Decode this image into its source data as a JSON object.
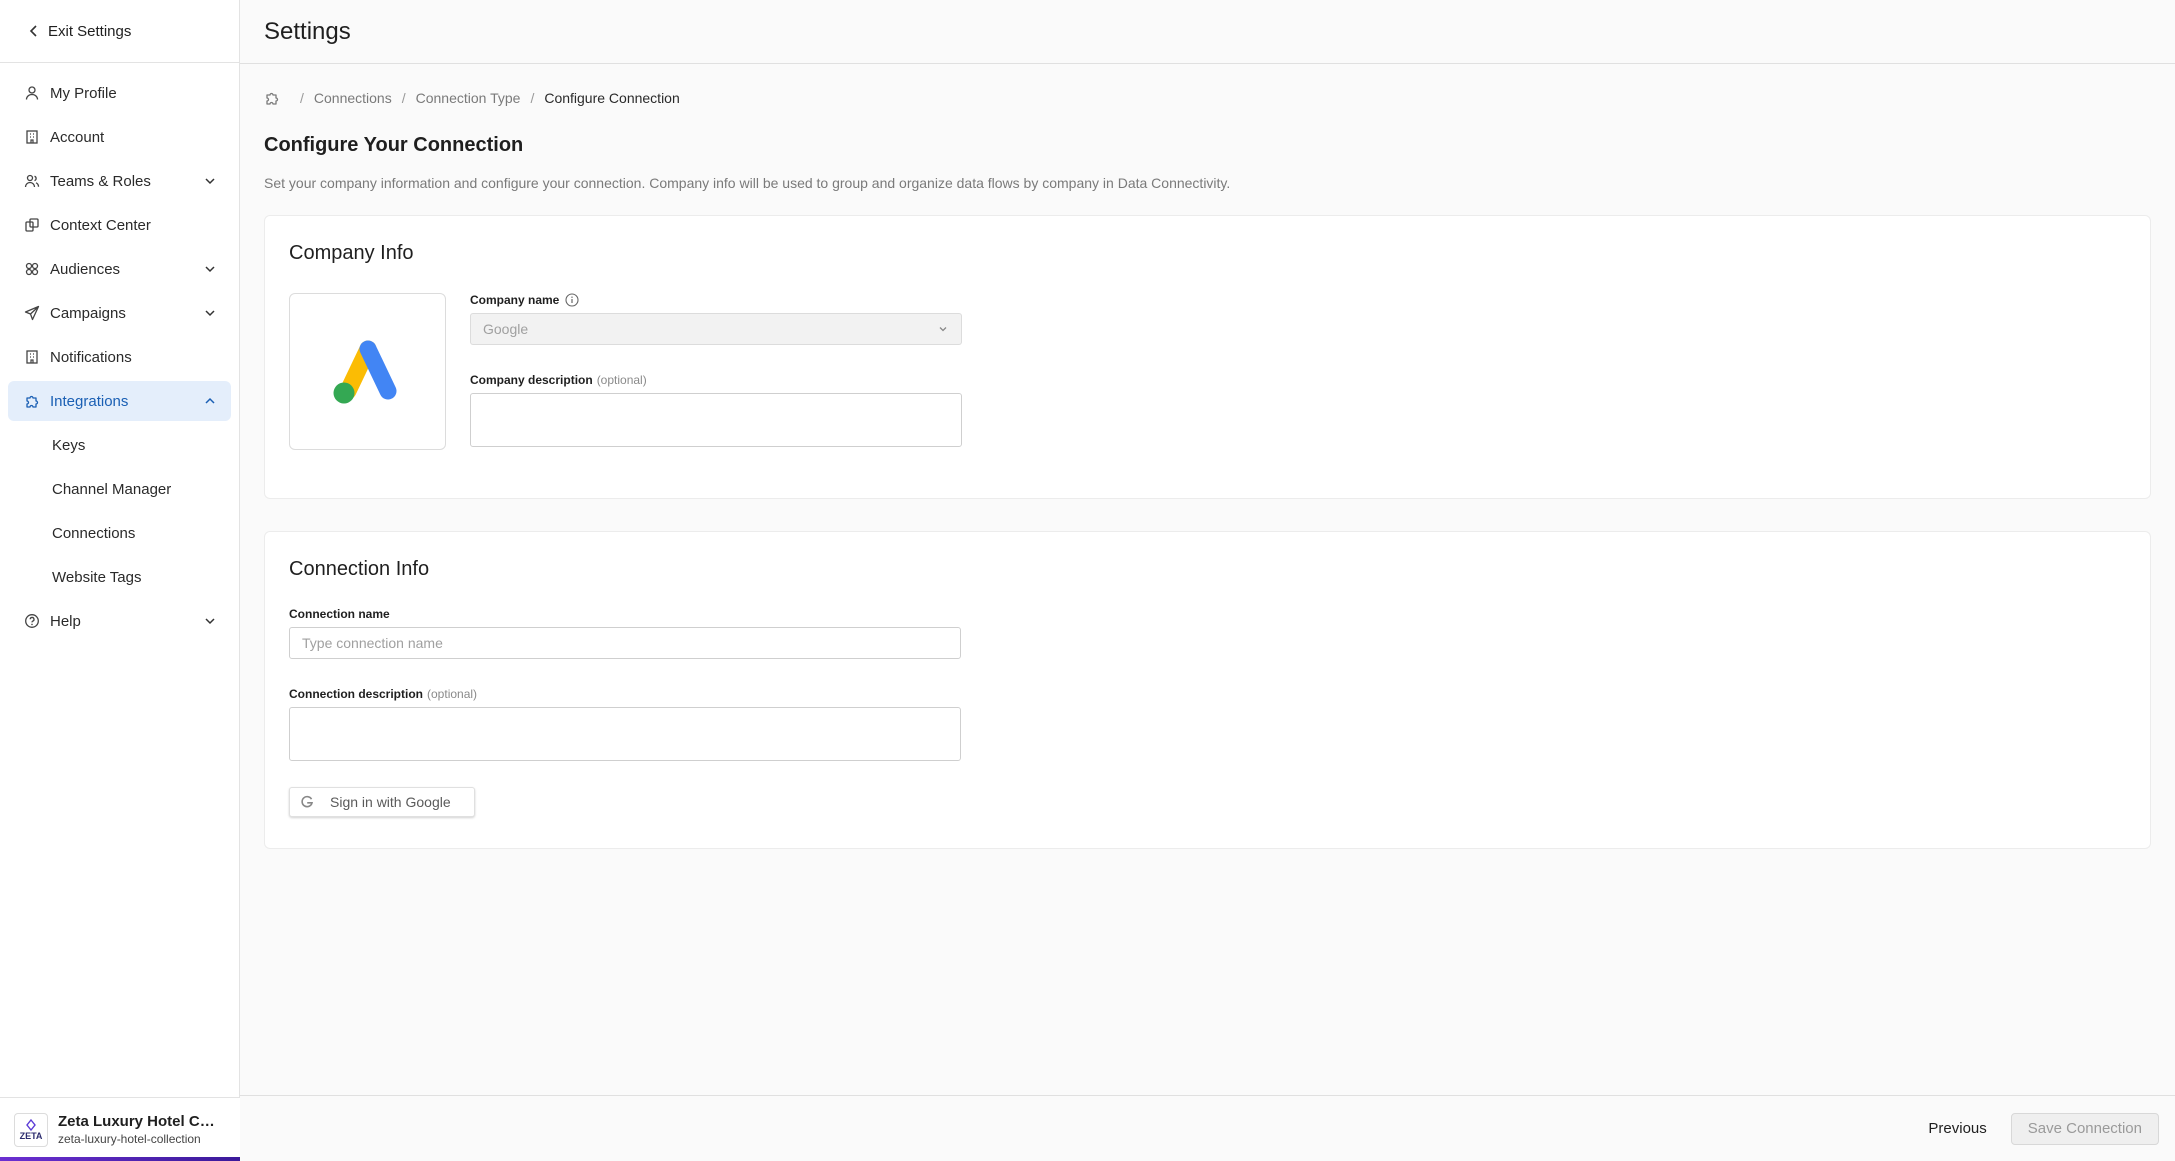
{
  "sidebar": {
    "exit_label": "Exit Settings",
    "items": [
      {
        "label": "My Profile"
      },
      {
        "label": "Account"
      },
      {
        "label": "Teams & Roles"
      },
      {
        "label": "Context Center"
      },
      {
        "label": "Audiences"
      },
      {
        "label": "Campaigns"
      },
      {
        "label": "Notifications"
      },
      {
        "label": "Integrations"
      },
      {
        "label": "Help"
      }
    ],
    "integrations_sub": [
      {
        "label": "Keys"
      },
      {
        "label": "Channel Manager"
      },
      {
        "label": "Connections"
      },
      {
        "label": "Website Tags"
      }
    ],
    "org": {
      "name": "Zeta Luxury Hotel Colle...",
      "slug": "zeta-luxury-hotel-collection",
      "logo_text": "ZETA"
    }
  },
  "header": {
    "title": "Settings"
  },
  "breadcrumb": {
    "items": [
      "Connections",
      "Connection Type"
    ],
    "current": "Configure Connection",
    "separator": "/"
  },
  "page": {
    "title": "Configure Your Connection",
    "subtitle": "Set your company information and configure your connection. Company info will be used to group and organize data flows by company in Data Connectivity."
  },
  "company_info": {
    "title": "Company Info",
    "name_label": "Company name",
    "name_value": "Google",
    "description_label": "Company description",
    "optional": "(optional)"
  },
  "connection_info": {
    "title": "Connection Info",
    "name_label": "Connection name",
    "name_placeholder": "Type connection name",
    "description_label": "Connection description",
    "optional": "(optional)",
    "google_button": "Sign in with Google"
  },
  "footer": {
    "previous": "Previous",
    "save": "Save Connection"
  },
  "colors": {
    "active_bg": "#e4eefb",
    "active_text": "#1a5fb4",
    "google_blue": "#4285f4",
    "google_yellow": "#fbbc04",
    "google_green": "#34a853"
  }
}
